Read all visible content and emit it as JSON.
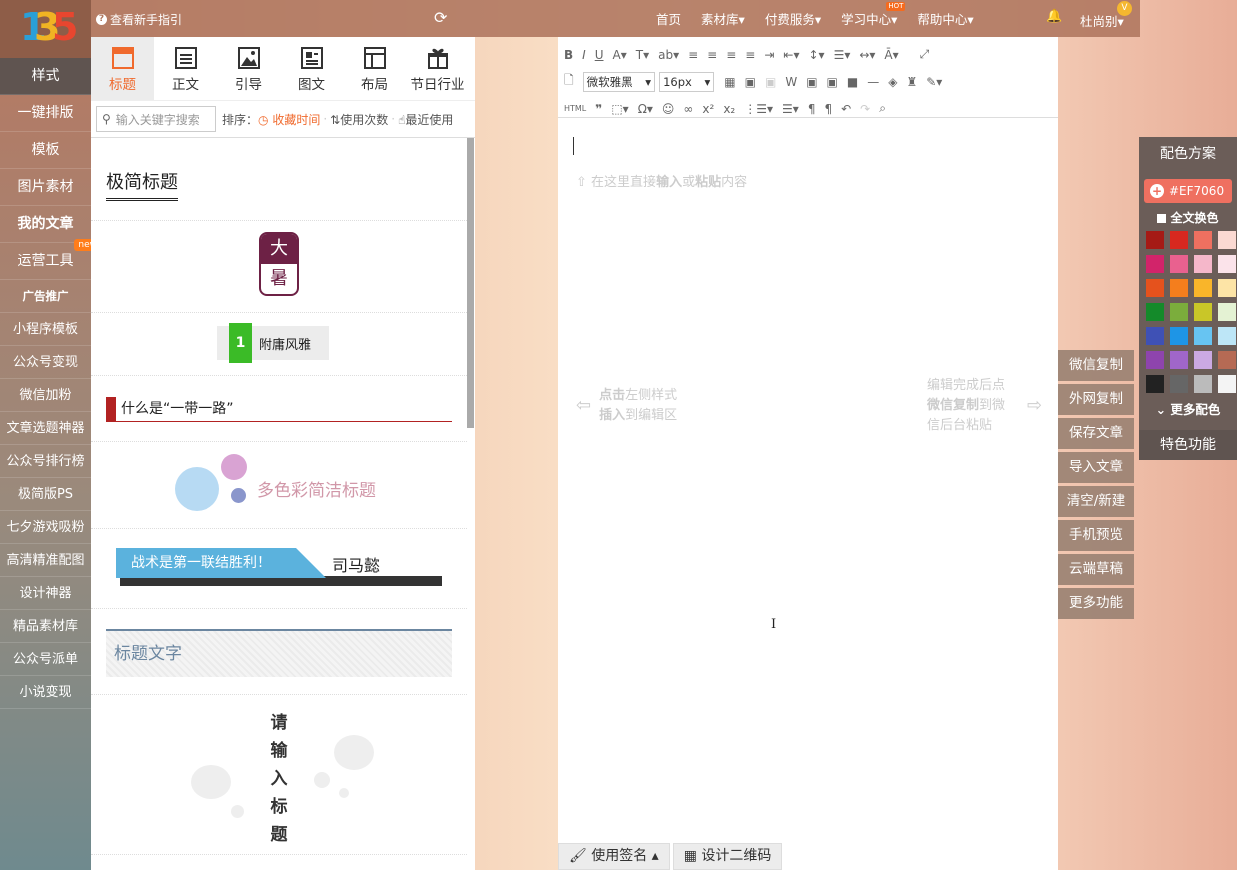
{
  "logo": {
    "text": "135",
    "colors": [
      "#2a9fd8",
      "#f0b323",
      "#e8462f"
    ]
  },
  "topbar": {
    "guide": "查看新手指引",
    "nav": [
      {
        "label": "首页",
        "dd": false
      },
      {
        "label": "素材库",
        "dd": true
      },
      {
        "label": "付费服务",
        "dd": true
      },
      {
        "label": "学习中心",
        "dd": true
      },
      {
        "label": "帮助中心",
        "dd": true
      }
    ],
    "hot": "HOT",
    "user": "杜尚别",
    "vip": "V"
  },
  "sidebar": {
    "items": [
      "样式",
      "一键排版",
      "模板",
      "图片素材",
      "我的文章",
      "运营工具",
      "广告推广",
      "小程序模板",
      "公众号变现",
      "微信加粉",
      "文章选题神器",
      "公众号排行榜",
      "极简版PS",
      "七夕游戏吸粉",
      "高清精准配图",
      "设计神器",
      "精品素材库",
      "公众号派单",
      "小说变现"
    ],
    "new_badge": "new"
  },
  "categories": [
    {
      "label": "标题",
      "icon": "title-icon"
    },
    {
      "label": "正文",
      "icon": "text-icon"
    },
    {
      "label": "引导",
      "icon": "image-icon"
    },
    {
      "label": "图文",
      "icon": "image-text-icon"
    },
    {
      "label": "布局",
      "icon": "layout-icon"
    },
    {
      "label": "节日行业",
      "icon": "gift-icon"
    }
  ],
  "search": {
    "placeholder": "输入关键字搜索",
    "sort_label": "排序：",
    "sort_options": [
      "收藏时间",
      "使用次数",
      "最近使用"
    ]
  },
  "materials": {
    "m1": "极简标题",
    "m2": [
      "大",
      "暑"
    ],
    "m3": {
      "num": "1",
      "text": "附庸风雅"
    },
    "m4": "什么是“一带一路”",
    "m5": "多色彩简洁标题",
    "m6": {
      "banner": "战术是第一联结胜利！",
      "name": "司马懿"
    },
    "m7": "标题文字",
    "m8": [
      "请",
      "输",
      "入",
      "标",
      "题"
    ]
  },
  "editor": {
    "font": "微软雅黑",
    "size": "16px",
    "placeholder_bold": [
      "输入",
      "粘贴"
    ],
    "placeholder_parts": [
      "在这里直接",
      "或",
      "内容"
    ],
    "left_hint": [
      "点击",
      "左侧样式",
      "插入",
      "到编辑区"
    ],
    "right_hint": [
      "编辑完成后点",
      "微信复制",
      "到微",
      "信后台粘贴"
    ],
    "bottom": [
      "使用签名",
      "设计二维码"
    ]
  },
  "actions": [
    "微信复制",
    "外网复制",
    "保存文章",
    "导入文章",
    "清空/新建",
    "手机预览",
    "云端草稿",
    "更多功能"
  ],
  "colors": {
    "title": "配色方案",
    "current": "#EF7060",
    "all": "全文换色",
    "more": "更多配色",
    "special": "特色功能",
    "swatches": [
      "#a51a15",
      "#d7281f",
      "#ef7060",
      "#fbd9d2",
      "#d2246a",
      "#e9618f",
      "#f5b7ca",
      "#fbe3ea",
      "#e5521d",
      "#f47e1d",
      "#f9b52a",
      "#fde4a6",
      "#148a2a",
      "#7bad3c",
      "#c9c628",
      "#e4f2d3",
      "#3f51b5",
      "#1e95e6",
      "#67c4f2",
      "#bde6f7",
      "#8e44ad",
      "#a066c9",
      "#cba9e3",
      "#b66a54",
      "#222222",
      "#666666",
      "#bbbbbb",
      "#f4f4f4"
    ]
  }
}
